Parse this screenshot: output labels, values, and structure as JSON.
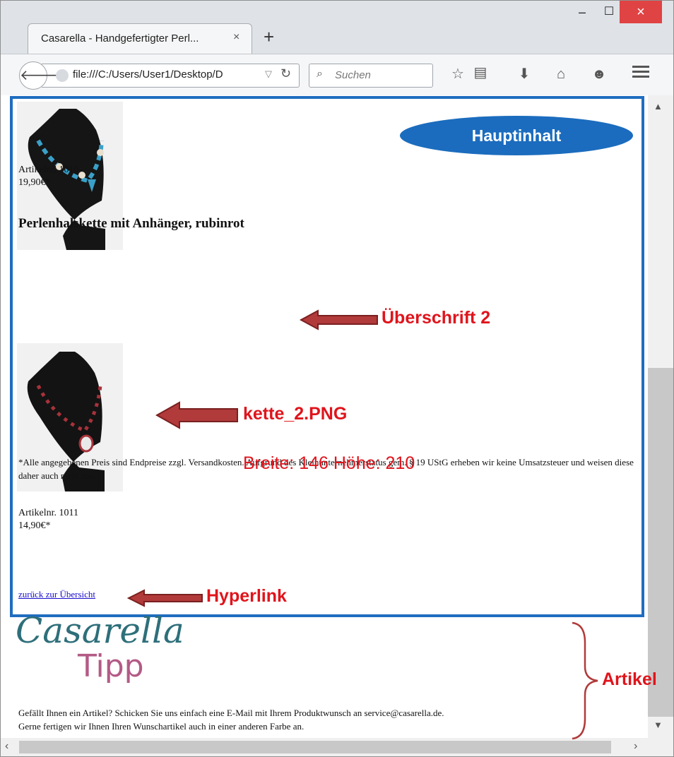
{
  "browser": {
    "tab_title": "Casarella - Handgefertigter Perl...",
    "tab_close": "×",
    "new_tab": "+",
    "window_controls": {
      "minimize": "–",
      "maximize": "☐",
      "close": "×"
    },
    "url": "file:///C:/Users/User1/Desktop/D",
    "search_placeholder": "Suchen",
    "icons": [
      "back-icon",
      "globe-icon",
      "reload-icon",
      "search-icon",
      "bookmark-star-icon",
      "reading-list-icon",
      "download-icon",
      "home-icon",
      "chat-icon",
      "menu-icon"
    ]
  },
  "page": {
    "item1": {
      "artikelnr": "Artikelnr. 1010",
      "price": "19,90€*"
    },
    "heading2": "Perlenhalskette mit Anhänger, rubinrot",
    "item2": {
      "artikelnr": "Artikelnr. 1011",
      "price": "14,90€*"
    },
    "footnote": "*Alle angegebenen Preis sind Endpreise zzgl. Versandkosten. Aufgrund des Kleinunternehmerstatus gem. § 19 UStG erheben wir keine Umsatzsteuer und weisen diese daher auch nicht aus.",
    "back_link": "zurück zur Übersicht",
    "logo": {
      "line1": "Casarella",
      "line2": "Tipp"
    },
    "footer_line1": "Gefällt Ihnen ein Artikel? Schicken Sie uns einfach eine E-Mail mit Ihrem Produktwunsch an service@casarella.de.",
    "footer_line2": "Gerne fertigen wir Ihnen Ihren Wunschartikel auch in einer anderen Farbe an."
  },
  "annotations": {
    "main_label": "Hauptinhalt",
    "heading_label": "Überschrift 2",
    "image_label": "kette_2.PNG",
    "image_dims": "Breite: 146 Höhe: 210",
    "link_label": "Hyperlink",
    "article_label": "Artikel"
  },
  "colors": {
    "annotation_red": "#e0141c",
    "annotation_blue": "#1b6cbe",
    "arrow_fill": "#b13a3a",
    "logo_teal": "#2e6f7a",
    "logo_pink": "#b35a86"
  }
}
